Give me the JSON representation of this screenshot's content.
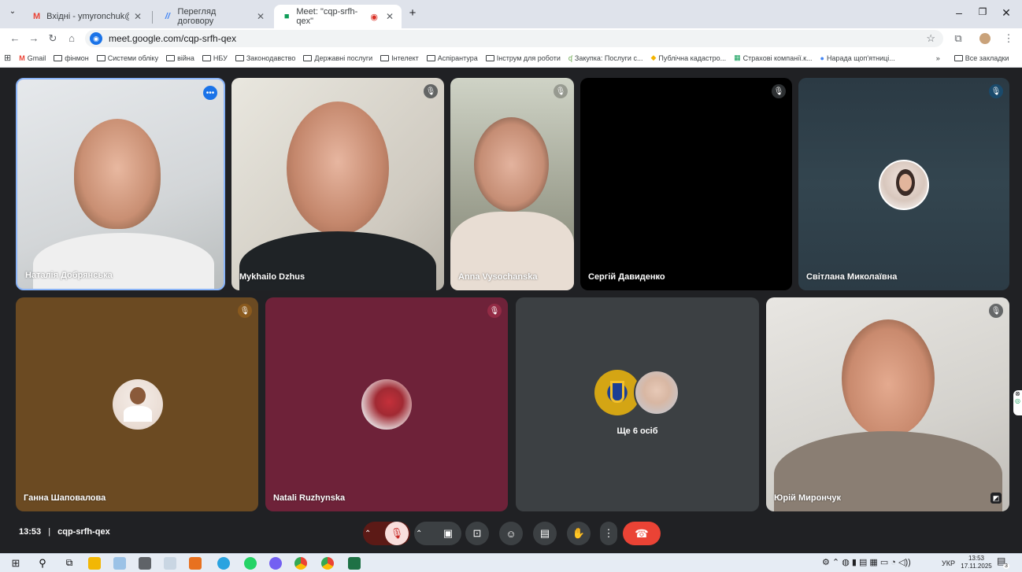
{
  "browser": {
    "tabs": [
      {
        "title": "Вхідні - ymyronchuk@gmail.co",
        "active": false
      },
      {
        "title": "Перегляд договору",
        "active": false
      },
      {
        "title": "Meet: \"cqp-srfh-qex\"",
        "active": true
      }
    ],
    "new_tab_icon": "plus-icon",
    "url": "meet.google.com/cqp-srfh-qex",
    "bookmarks": [
      "Gmail",
      "фінмон",
      "Системи обліку",
      "війна",
      "НБУ",
      "Законодавство",
      "Державні послуги",
      "Інтелект",
      "Аспірантура",
      "Інструм для роботи",
      "Закупка: Послуги с...",
      "Публічна кадастро...",
      "Страхові компанії.к...",
      "Нарада щоп'ятниці..."
    ],
    "bookmarks_overflow": "»",
    "all_bookmarks": "Все закладки"
  },
  "meet": {
    "participants": [
      {
        "name": "Наталія Добрянська",
        "muted": false
      },
      {
        "name": "Mykhailo Dzhus",
        "muted": true
      },
      {
        "name": "Anna Vysochanska",
        "muted": true
      },
      {
        "name": "Сергій Давиденко",
        "muted": true
      },
      {
        "name": "Світлана Миколаївна",
        "muted": true
      },
      {
        "name": "Ганна Шаповалова",
        "muted": true
      },
      {
        "name": "Natali Ruzhynska",
        "muted": true
      },
      {
        "name": "Юрій Мирончук",
        "muted": true
      }
    ],
    "others_label": "Ще 6 осіб",
    "time": "13:53",
    "separator": "|",
    "meeting_code": "cqp-srfh-qex",
    "colors": {
      "background": "#202124",
      "end_call": "#ea4335",
      "mic_muted": "#f9dedc",
      "tile_gray": "#3c4043"
    }
  },
  "taskbar": {
    "language": "УКР",
    "time": "13:53",
    "date": "17.11.2025",
    "notification_count": "3"
  }
}
